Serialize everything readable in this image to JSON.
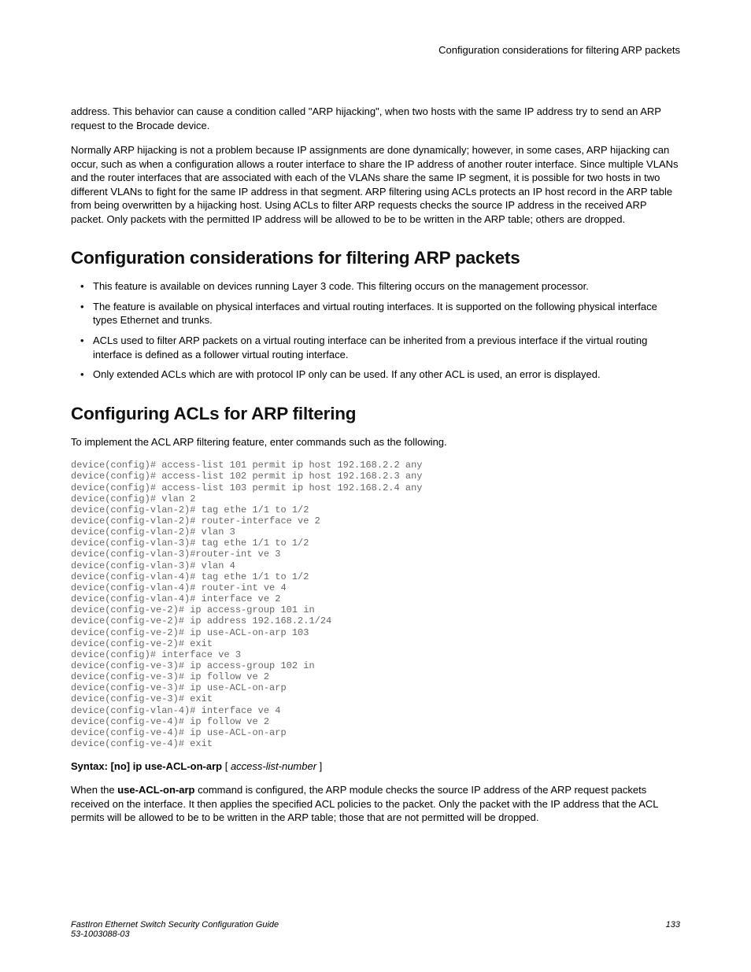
{
  "header": {
    "running": "Configuration considerations for filtering ARP packets"
  },
  "intro": {
    "p1": "address. This behavior can cause a condition called \"ARP hijacking\", when two hosts with the same IP address try to send an ARP request to the Brocade device.",
    "p2": "Normally ARP hijacking is not a problem because IP assignments are done dynamically; however, in some cases, ARP hijacking can occur, such as when a configuration allows a router interface to share the IP address of another router interface. Since multiple VLANs and the router interfaces that are associated with each of the VLANs share the same IP segment, it is possible for two hosts in two different VLANs to fight for the same IP address in that segment. ARP filtering using ACLs protects an IP host record in the ARP table from being overwritten by a hijacking host. Using ACLs to filter ARP requests checks the source IP address in the received ARP packet. Only packets with the permitted IP address will be allowed to be to be written in the ARP table; others are dropped."
  },
  "section1": {
    "title": "Configuration considerations for filtering ARP packets",
    "bullets": [
      "This feature is available on devices running Layer 3 code. This filtering occurs on the management processor.",
      "The feature is available on physical interfaces and virtual routing interfaces. It is supported on the following physical interface types Ethernet and trunks.",
      "ACLs used to filter ARP packets on a virtual routing interface can be inherited from a previous interface if the virtual routing interface is defined as a follower virtual routing interface.",
      "Only extended ACLs which are with protocol IP only can be used. If any other ACL is used, an error is displayed."
    ]
  },
  "section2": {
    "title": "Configuring ACLs for ARP filtering",
    "lead": "To implement the ACL ARP filtering feature, enter commands such as the following.",
    "code": "device(config)# access-list 101 permit ip host 192.168.2.2 any\ndevice(config)# access-list 102 permit ip host 192.168.2.3 any\ndevice(config)# access-list 103 permit ip host 192.168.2.4 any\ndevice(config)# vlan 2\ndevice(config-vlan-2)# tag ethe 1/1 to 1/2\ndevice(config-vlan-2)# router-interface ve 2\ndevice(config-vlan-2)# vlan 3\ndevice(config-vlan-3)# tag ethe 1/1 to 1/2\ndevice(config-vlan-3)#router-int ve 3\ndevice(config-vlan-3)# vlan 4\ndevice(config-vlan-4)# tag ethe 1/1 to 1/2\ndevice(config-vlan-4)# router-int ve 4\ndevice(config-vlan-4)# interface ve 2\ndevice(config-ve-2)# ip access-group 101 in\ndevice(config-ve-2)# ip address 192.168.2.1/24\ndevice(config-ve-2)# ip use-ACL-on-arp 103\ndevice(config-ve-2)# exit\ndevice(config)# interface ve 3\ndevice(config-ve-3)# ip access-group 102 in\ndevice(config-ve-3)# ip follow ve 2\ndevice(config-ve-3)# ip use-ACL-on-arp\ndevice(config-ve-3)# exit\ndevice(config-vlan-4)# interface ve 4\ndevice(config-ve-4)# ip follow ve 2\ndevice(config-ve-4)# ip use-ACL-on-arp\ndevice(config-ve-4)# exit",
    "syntax": {
      "label": "Syntax: [no] ip use-ACL-on-arp",
      "open": " [ ",
      "arg": "access-list-number",
      "close": " ]"
    },
    "followup_pre": "When the ",
    "followup_cmd": "use-ACL-on-arp",
    "followup_post": " command is configured, the ARP module checks the source IP address of the ARP request packets received on the interface. It then applies the specified ACL policies to the packet. Only the packet with the IP address that the ACL permits will be allowed to be to be written in the ARP table; those that are not permitted will be dropped."
  },
  "footer": {
    "guide": "FastIron Ethernet Switch Security Configuration Guide",
    "docnum": "53-1003088-03",
    "page": "133"
  }
}
